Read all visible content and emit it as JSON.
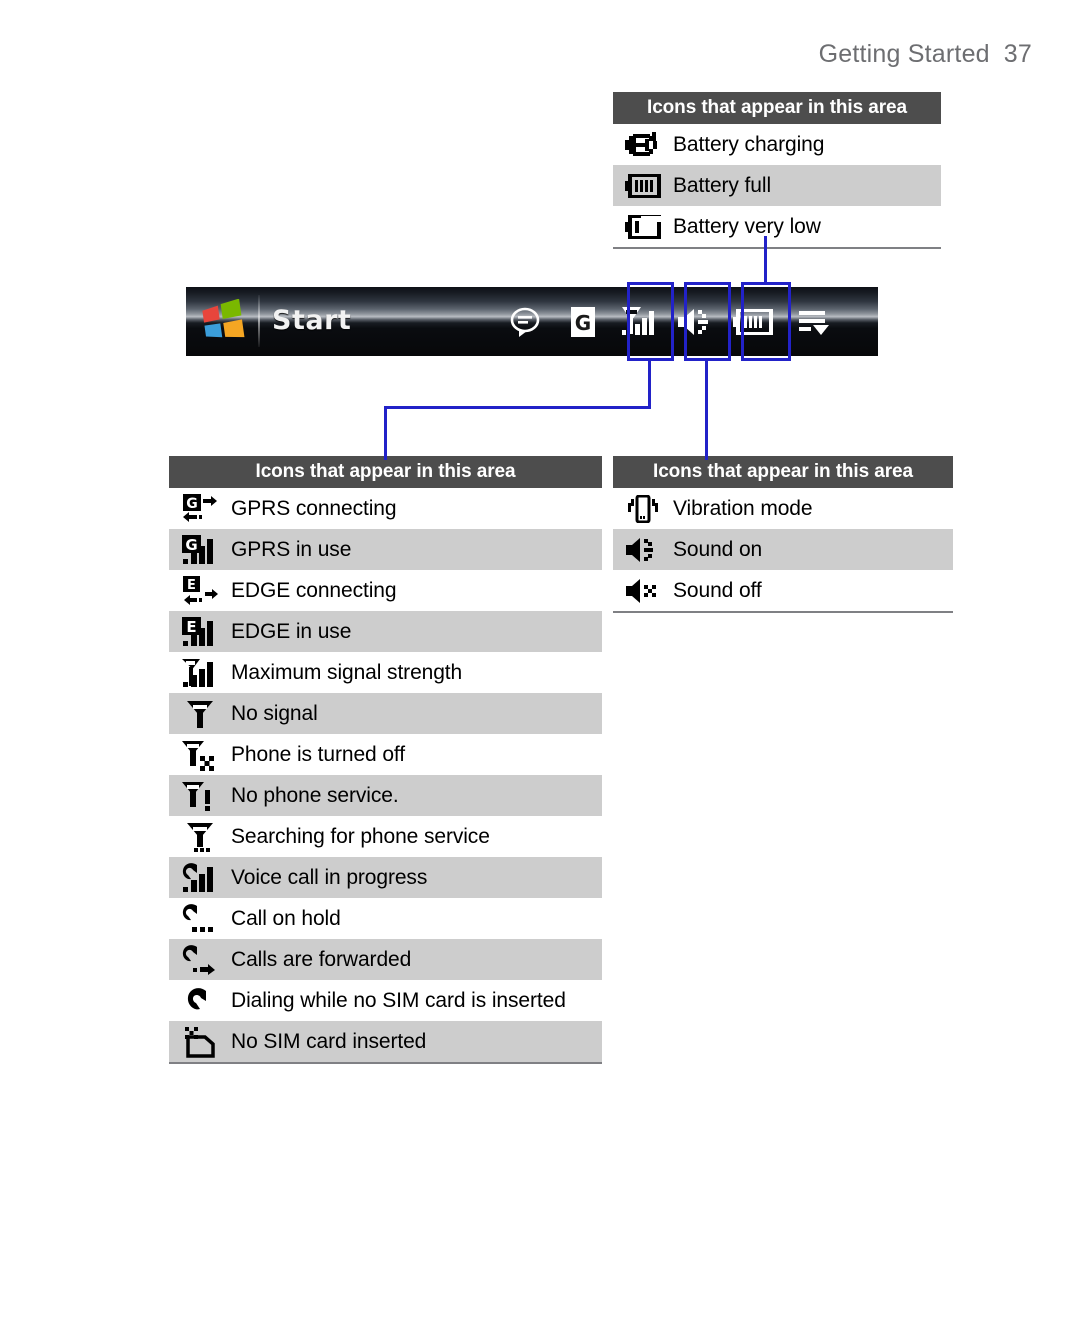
{
  "header": {
    "title": "Getting Started",
    "page_number": "37"
  },
  "tables": {
    "battery": {
      "heading": "Icons that appear in this area",
      "rows": [
        {
          "icon": "battery-charging-icon",
          "label": "Battery charging"
        },
        {
          "icon": "battery-full-icon",
          "label": "Battery full"
        },
        {
          "icon": "battery-very-low-icon",
          "label": "Battery very low"
        }
      ]
    },
    "sound": {
      "heading": "Icons that appear in this area",
      "rows": [
        {
          "icon": "vibration-mode-icon",
          "label": "Vibration mode"
        },
        {
          "icon": "sound-on-icon",
          "label": "Sound on"
        },
        {
          "icon": "sound-off-icon",
          "label": "Sound off"
        }
      ]
    },
    "signal": {
      "heading": "Icons that appear in this area",
      "rows": [
        {
          "icon": "gprs-connecting-icon",
          "label": "GPRS connecting"
        },
        {
          "icon": "gprs-in-use-icon",
          "label": "GPRS in use"
        },
        {
          "icon": "edge-connecting-icon",
          "label": "EDGE connecting"
        },
        {
          "icon": "edge-in-use-icon",
          "label": "EDGE in use"
        },
        {
          "icon": "maximum-signal-strength-icon",
          "label": "Maximum signal strength"
        },
        {
          "icon": "no-signal-icon",
          "label": "No signal"
        },
        {
          "icon": "phone-off-icon",
          "label": "Phone is turned off"
        },
        {
          "icon": "no-phone-service-icon",
          "label": "No phone service."
        },
        {
          "icon": "searching-for-service-icon",
          "label": "Searching for phone service"
        },
        {
          "icon": "voice-call-in-progress-icon",
          "label": "Voice call in progress"
        },
        {
          "icon": "call-on-hold-icon",
          "label": "Call on hold"
        },
        {
          "icon": "calls-forwarded-icon",
          "label": "Calls are forwarded"
        },
        {
          "icon": "dialing-no-sim-icon",
          "label": "Dialing while no SIM card is inserted"
        },
        {
          "icon": "no-sim-card-icon",
          "label": "No SIM card inserted"
        }
      ]
    }
  },
  "start_bar": {
    "logo": "windows-logo-icon",
    "start_label": "Start",
    "icons": [
      {
        "name": "messaging-icon"
      },
      {
        "name": "gprs-indicator-icon"
      },
      {
        "name": "signal-strength-icon"
      },
      {
        "name": "sound-on-indicator-icon"
      },
      {
        "name": "battery-indicator-icon"
      },
      {
        "name": "menu-icon"
      }
    ]
  },
  "colors": {
    "heading_bg": "#4d4d4d",
    "row_alt_bg": "#cdcdcd",
    "callout_line": "#2222c8",
    "header_text": "#6d6e71",
    "table_border": "#7f8084"
  }
}
